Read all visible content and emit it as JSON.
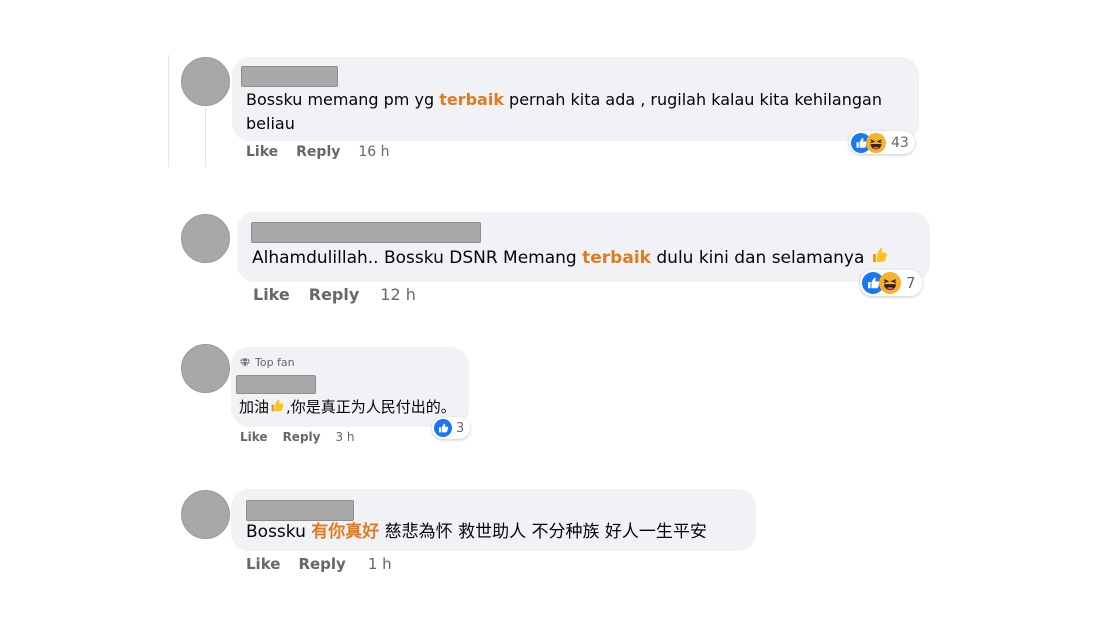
{
  "comments": [
    {
      "text_parts": [
        "Bossku memang pm yg ",
        "terbaik",
        " pernah kita ada , rugilah kalau kita kehilangan",
        "beliau"
      ],
      "actions": {
        "like": "Like",
        "reply": "Reply",
        "time": "16 h"
      },
      "reactions": {
        "icons": [
          "like-icon",
          "haha-icon"
        ],
        "count": "43"
      }
    },
    {
      "text_parts": [
        "Alhamdulillah.. Bossku DSNR Memang ",
        "terbaik",
        " dulu kini dan selamanya"
      ],
      "actions": {
        "like": "Like",
        "reply": "Reply",
        "time": "12 h"
      },
      "reactions": {
        "icons": [
          "like-icon",
          "haha-icon"
        ],
        "count": "7"
      }
    },
    {
      "badge": "Top fan",
      "text_parts": [
        "加油",
        ",你是真正为人民付出的。"
      ],
      "actions": {
        "like": "Like",
        "reply": "Reply",
        "time": "3 h"
      },
      "reactions": {
        "icons": [
          "like-icon"
        ],
        "count": "3"
      }
    },
    {
      "text_parts": [
        "Bossku ",
        "有你真好",
        " 慈悲為怀 救世助人 不分种族 好人一生平安"
      ],
      "actions": {
        "like": "Like",
        "reply": "Reply",
        "time": "1 h"
      }
    }
  ],
  "colors": {
    "highlight": "#e07b21",
    "bubble": "#f0f2f5",
    "meta": "#65676b",
    "like_blue": "#1877f2",
    "haha_yellow": "#f7b125"
  }
}
